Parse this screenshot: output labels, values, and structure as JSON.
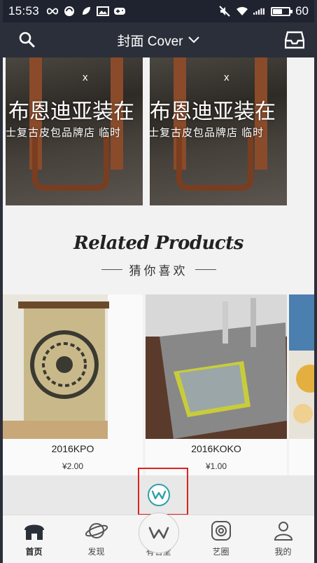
{
  "status_bar": {
    "time": "15:53",
    "battery_level": "60",
    "battery_fraction": 0.6
  },
  "header": {
    "title": "封面 Cover",
    "chevron": "chevron-down-icon"
  },
  "banners": [
    {
      "text_main": "布恩迪亚装在",
      "text_sub": "士复古皮包品牌店  临时",
      "close": "x"
    },
    {
      "text_main": "布恩迪亚装在",
      "text_sub": "士复古皮包品牌店  临时",
      "close": "x"
    }
  ],
  "related": {
    "title": "Related Products",
    "subtitle": "猜你喜欢"
  },
  "products": [
    {
      "name": "2016KPO",
      "price": "¥2.00"
    },
    {
      "name": "2016KOKO",
      "price": "¥1.00"
    }
  ],
  "tab_bar": {
    "items": [
      {
        "label": "首页",
        "icon": "home-icon",
        "active": true
      },
      {
        "label": "发现",
        "icon": "planet-icon",
        "active": false
      },
      {
        "label": "有名堂",
        "icon": "app-logo-icon",
        "active": false
      },
      {
        "label": "艺圈",
        "icon": "fingerprint-icon",
        "active": false
      },
      {
        "label": "我的",
        "icon": "user-icon",
        "active": false
      }
    ]
  },
  "colors": {
    "status_bar": "#1f2330",
    "header": "#2b2f3a",
    "accent_teal": "#2fa0a8",
    "highlight": "#e02020"
  }
}
